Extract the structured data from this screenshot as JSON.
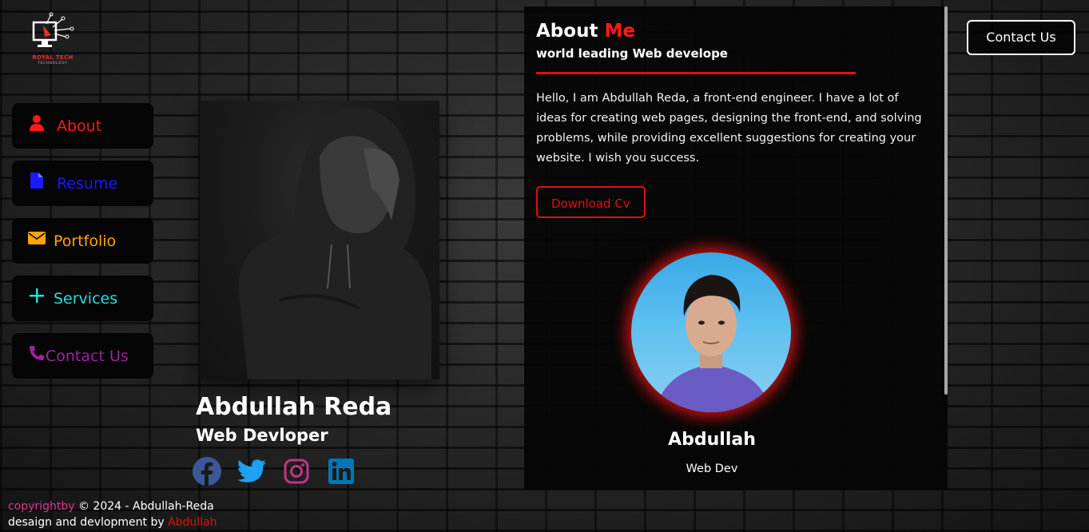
{
  "logo": {
    "name": "ROYAL TECH",
    "tagline": "TECHNOLOGY"
  },
  "nav": {
    "items": [
      {
        "label": "About",
        "icon": "user-icon",
        "color": "#ff1a1a"
      },
      {
        "label": "Resume",
        "icon": "file-icon",
        "color": "#1a1aff"
      },
      {
        "label": "Portfolio",
        "icon": "envelope-icon",
        "color": "#ffa500"
      },
      {
        "label": "Services",
        "icon": "plus-icon",
        "color": "#22e0e0"
      },
      {
        "label": "Contact Us",
        "icon": "phone-icon",
        "color": "#a020a0"
      }
    ]
  },
  "profile": {
    "name": "Abdullah Reda",
    "role": "Web Devloper",
    "socials": [
      {
        "icon": "facebook-icon",
        "color": "#3b5998"
      },
      {
        "icon": "twitter-icon",
        "color": "#1da1f2"
      },
      {
        "icon": "instagram-icon",
        "color": "#c13584"
      },
      {
        "icon": "linkedin-icon",
        "color": "#0077b5"
      }
    ]
  },
  "about": {
    "title_prefix": "About",
    "title_accent": "Me",
    "subtitle": "world leading Web develope",
    "text": "Hello, I am Abdullah Reda, a front-end engineer. I have a lot of ideas for creating web pages, designing the front-end, and solving problems, while providing excellent suggestions for creating your website. I wish you success.",
    "download_label": "Download Cv",
    "card_name": "Abdullah",
    "card_role": "Web Dev"
  },
  "header": {
    "contact_label": "Contact Us"
  },
  "footer": {
    "copyright_word": "copyrightby",
    "copyright_rest": " © 2024 - Abdullah-Reda",
    "credit_prefix": "desaign and devlopment by ",
    "credit_name": "Abdullah"
  },
  "colors": {
    "accent": "#e01010"
  }
}
